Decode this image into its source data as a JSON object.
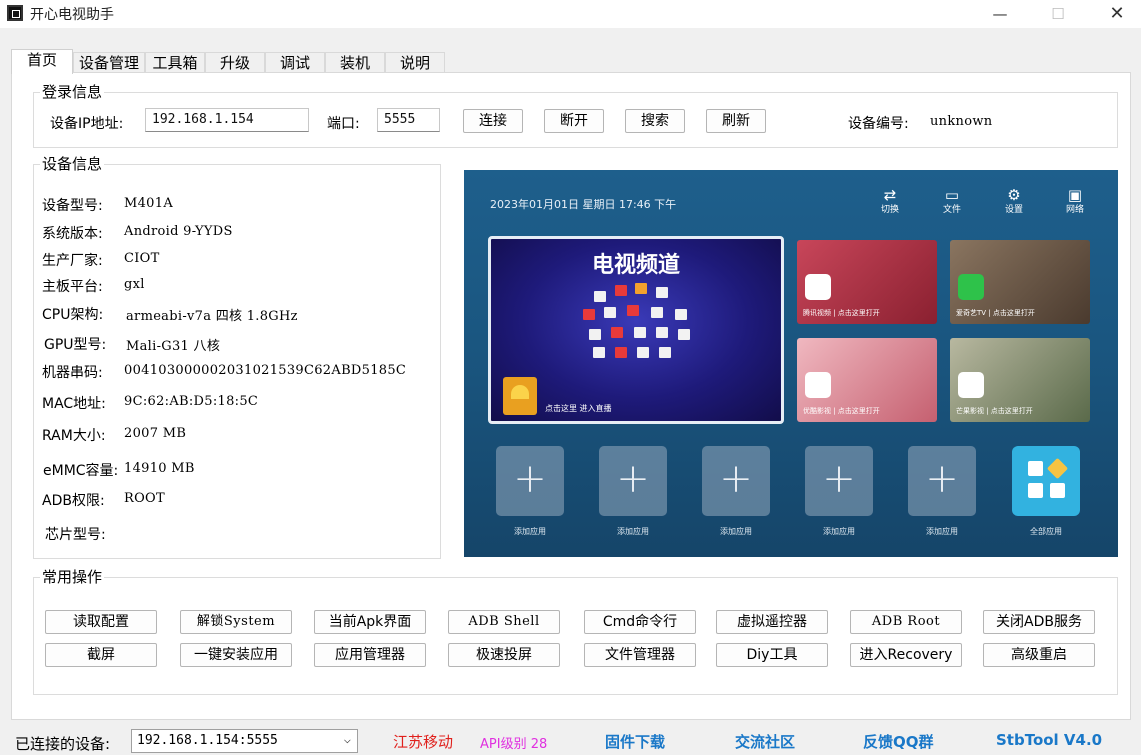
{
  "window": {
    "title": "开心电视助手",
    "min_glyph": "—",
    "max_glyph": "☐",
    "close_glyph": "✕"
  },
  "tabs": [
    "首页",
    "设备管理",
    "工具箱",
    "升级",
    "调试",
    "装机",
    "说明"
  ],
  "active_tab": "首页",
  "login": {
    "group_title": "登录信息",
    "ip_label": "设备IP地址:",
    "ip_value": "192.168.1.154",
    "port_label": "端口:",
    "port_value": "5555",
    "buttons": [
      "连接",
      "断开",
      "搜索",
      "刷新"
    ],
    "device_id_label": "设备编号:",
    "device_id_value": "unknown"
  },
  "device_info": {
    "group_title": "设备信息",
    "rows": [
      {
        "label": "设备型号:",
        "value": "M401A"
      },
      {
        "label": "系统版本:",
        "value": "Android 9-YYDS"
      },
      {
        "label": "生产厂家:",
        "value": "CIOT"
      },
      {
        "label": "主板平台:",
        "value": "gxl"
      },
      {
        "label": "CPU架构:",
        "value": "armeabi-v7a 四核 1.8GHz"
      },
      {
        "label": "GPU型号:",
        "value": "Mali-G31 八核"
      },
      {
        "label": "机器串码:",
        "value": "0041030000020310215 39C62ABD5185C"
      },
      {
        "label": "MAC地址:",
        "value": "9C:62:AB:D5:18:5C"
      },
      {
        "label": "RAM大小:",
        "value": "2007 MB"
      },
      {
        "label": "eMMC容量:",
        "value": "14910 MB"
      },
      {
        "label": "ADB权限:",
        "value": "ROOT"
      },
      {
        "label": "芯片型号:",
        "value": ""
      }
    ]
  },
  "tv_preview": {
    "datetime": "2023年01月01日  星期日  17:46 下午",
    "top_icons": [
      {
        "icon": "switch-icon",
        "glyph": "⇄",
        "label": "切换"
      },
      {
        "icon": "file-icon",
        "glyph": "▭",
        "label": "文件"
      },
      {
        "icon": "settings-icon",
        "glyph": "⚙",
        "label": "设置"
      },
      {
        "icon": "network-icon",
        "glyph": "▣",
        "label": "网络"
      }
    ],
    "main_title": "电视频道",
    "main_caption": "点击这里  进入直播",
    "cards": [
      {
        "caption": "腾讯视频  |  点击这里打开",
        "bg": "#b8394a"
      },
      {
        "caption": "爱奇艺TV  |  点击这里打开",
        "bg": "#6b5a4a"
      },
      {
        "caption": "优酷影视  |  点击这里打开",
        "bg": "#d98a96"
      },
      {
        "caption": "芒果影视  |  点击这里打开",
        "bg": "#7a8a6a"
      }
    ],
    "add_label": "添加应用",
    "all_label": "全部应用"
  },
  "common_ops": {
    "group_title": "常用操作",
    "row1": [
      "读取配置",
      "解锁System",
      "当前Apk界面",
      "ADB Shell",
      "Cmd命令行",
      "虚拟遥控器",
      "ADB  Root",
      "关闭ADB服务"
    ],
    "row2": [
      "截屏",
      "一键安装应用",
      "应用管理器",
      "极速投屏",
      "文件管理器",
      "Diy工具",
      "进入Recovery",
      "高级重启"
    ]
  },
  "status": {
    "connected_label": "已连接的设备:",
    "connected_value": "192.168.1.154:5555",
    "isp": "江苏移动",
    "api": "API级别 28",
    "links": [
      "固件下载",
      "交流社区",
      "反馈QQ群",
      "StbTool V4.0"
    ]
  },
  "colors": {
    "isp": "#e0201c",
    "api": "#e030e0",
    "link": "#1a78c8"
  }
}
